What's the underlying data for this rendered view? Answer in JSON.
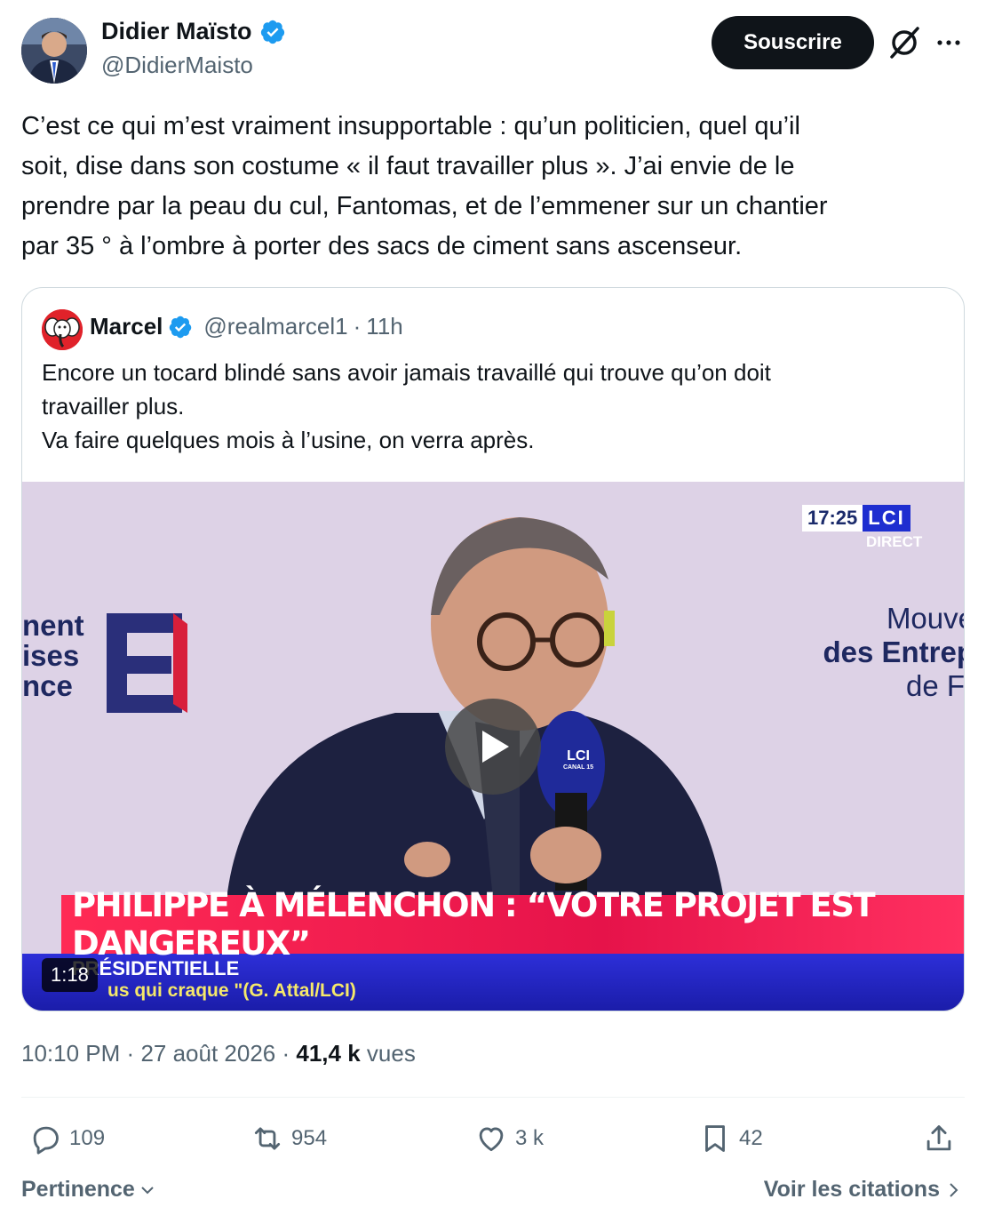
{
  "author": {
    "name": "Didier Maïsto",
    "handle": "@DidierMaisto",
    "verified": true,
    "avatar_icon": "profile-photo"
  },
  "header": {
    "subscribe_label": "Souscrire",
    "grok_icon": "grok-icon",
    "more_icon": "more-icon"
  },
  "tweet": {
    "text": "C’est ce qui m’est vraiment insupportable : qu’un politicien, quel qu’il\nsoit, dise dans son costume « il faut travailler plus ». J’ai envie de le\nprendre par la peau du cul, Fantomas, et de l’emmener sur un chantier\npar 35 ° à l’ombre à porter des sacs de ciment sans ascenseur."
  },
  "quote": {
    "name": "Marcel",
    "handle": "@realmarcel1",
    "separator": "·",
    "age": "11h",
    "text": "Encore un tocard blindé sans avoir jamais travaillé qui trouve qu’on doit\ntravailler plus.\nVa faire quelques mois à l’usine, on verra après.",
    "video": {
      "duration": "1:18",
      "clock": "17:25",
      "channel": "LCI",
      "live_label": "DIRECT",
      "headline": "PHILIPPE À MÉLENCHON : “VOTRE PROJET EST DANGEREUX”",
      "section_label": "PRÉSIDENTIELLE",
      "ticker": "us qui craque \"(G. Attal/LCI)",
      "wall_left": [
        "nent",
        "ises",
        "nce"
      ],
      "wall_right": [
        "Mouve",
        "des Entrep",
        "de Fr"
      ],
      "mic_label": "LCI",
      "mic_sub": "CANAL 15"
    }
  },
  "meta": {
    "time": "10:10 PM",
    "dot": "·",
    "date": "27 août 2026",
    "dot2": "·",
    "views": "41,4 k",
    "views_label": "vues"
  },
  "actions": {
    "replies": "109",
    "reposts": "954",
    "likes": "3 k",
    "bookmarks": "42"
  },
  "footer": {
    "sort_label": "Pertinence",
    "quotes_label": "Voir les citations"
  },
  "colors": {
    "text": "#0f1419",
    "secondary": "#536471",
    "verified": "#1d9bf0",
    "border": "#cfd9de"
  }
}
